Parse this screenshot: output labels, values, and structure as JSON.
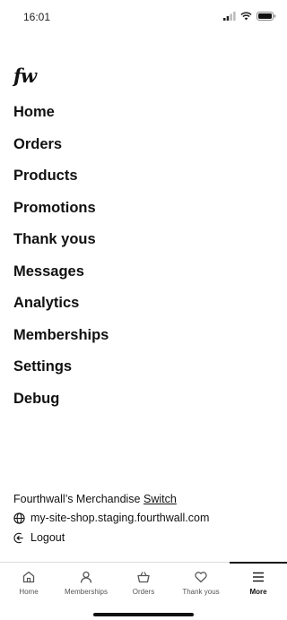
{
  "status_bar": {
    "time": "16:01"
  },
  "app": {
    "logo": "fw"
  },
  "nav": {
    "items": [
      {
        "label": "Home"
      },
      {
        "label": "Orders"
      },
      {
        "label": "Products"
      },
      {
        "label": "Promotions"
      },
      {
        "label": "Thank yous"
      },
      {
        "label": "Messages"
      },
      {
        "label": "Analytics"
      },
      {
        "label": "Memberships"
      },
      {
        "label": "Settings"
      },
      {
        "label": "Debug"
      }
    ]
  },
  "footer": {
    "store_name": "Fourthwall’s Merchandise",
    "switch_label": "Switch",
    "site_url": "my-site-shop.staging.fourthwall.com",
    "logout_label": "Logout"
  },
  "tab_bar": {
    "tabs": [
      {
        "label": "Home",
        "icon": "home-icon"
      },
      {
        "label": "Memberships",
        "icon": "person-icon"
      },
      {
        "label": "Orders",
        "icon": "basket-icon"
      },
      {
        "label": "Thank yous",
        "icon": "heart-icon"
      },
      {
        "label": "More",
        "icon": "menu-icon",
        "active": true
      }
    ]
  }
}
